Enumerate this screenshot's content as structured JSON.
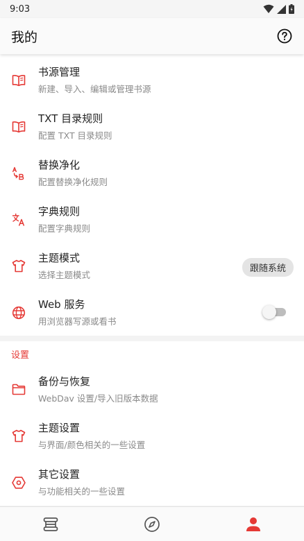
{
  "status_bar": {
    "time": "9:03"
  },
  "app_bar": {
    "title": "我的",
    "help_icon": "help-circle-icon"
  },
  "colors": {
    "accent": "#e53935",
    "icon_gray": "#555555"
  },
  "main_items": [
    {
      "icon": "book-open-icon",
      "title": "书源管理",
      "subtitle": "新建、导入、编辑或管理书源"
    },
    {
      "icon": "book-open-icon",
      "title": "TXT 目录规则",
      "subtitle": "配置 TXT 目录规则"
    },
    {
      "icon": "replace-ab-icon",
      "title": "替换净化",
      "subtitle": "配置替换净化规则"
    },
    {
      "icon": "translate-icon",
      "title": "字典规则",
      "subtitle": "配置字典规则"
    },
    {
      "icon": "shirt-icon",
      "title": "主题模式",
      "subtitle": "选择主题模式",
      "chip": "跟随系统"
    },
    {
      "icon": "globe-icon",
      "title": "Web 服务",
      "subtitle": "用浏览器写源或看书",
      "switch_on": false
    }
  ],
  "settings": {
    "header": "设置",
    "items": [
      {
        "icon": "folder-icon",
        "title": "备份与恢复",
        "subtitle": "WebDav 设置/导入旧版本数据"
      },
      {
        "icon": "shirt-icon",
        "title": "主题设置",
        "subtitle": "与界面/颜色相关的一些设置"
      },
      {
        "icon": "hexagon-settings-icon",
        "title": "其它设置",
        "subtitle": "与功能相关的一些设置"
      }
    ]
  },
  "bottom_nav": [
    {
      "icon": "bookshelf-icon",
      "active": false
    },
    {
      "icon": "compass-icon",
      "active": false
    },
    {
      "icon": "person-icon",
      "active": true
    }
  ]
}
